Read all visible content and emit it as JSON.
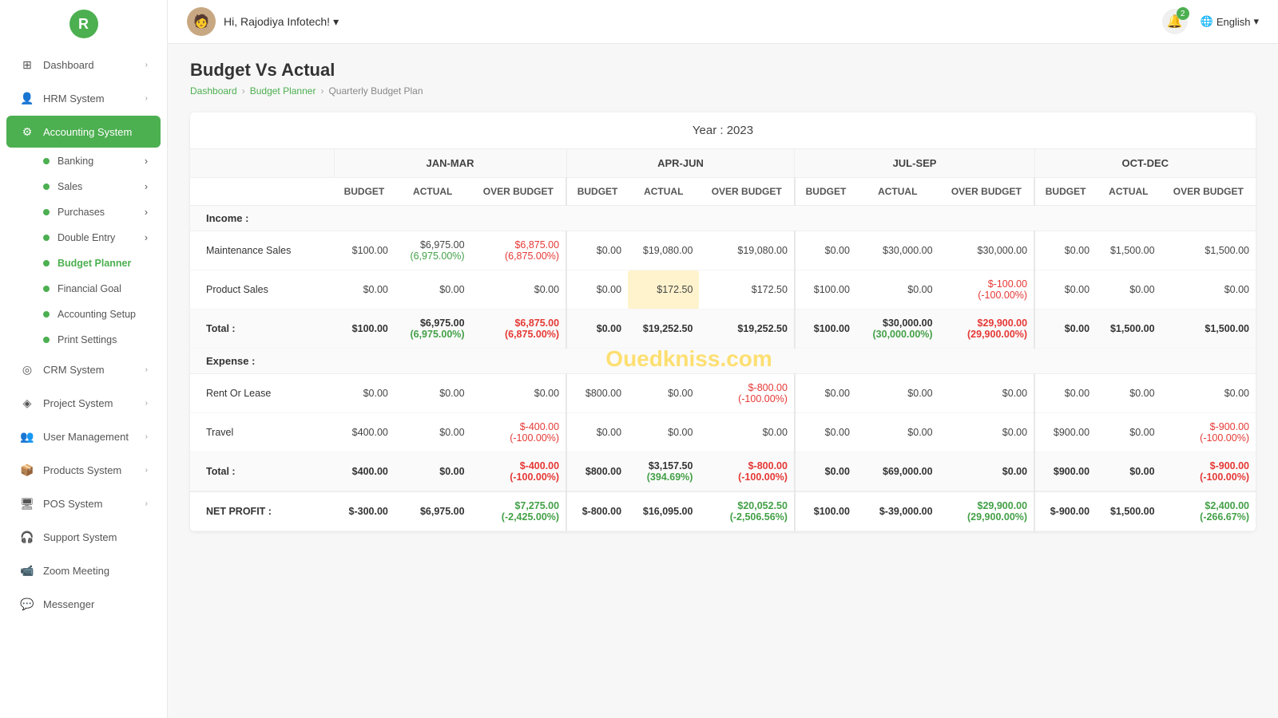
{
  "topbar": {
    "greeting": "Hi, Rajodiya Infotech!",
    "notif_count": "2",
    "language": "English"
  },
  "breadcrumb": {
    "home": "Dashboard",
    "parent": "Budget Planner",
    "current": "Quarterly Budget Plan"
  },
  "page": {
    "title": "Budget Vs Actual",
    "year_label": "Year : 2023"
  },
  "sidebar": {
    "logo_char": "R",
    "items": [
      {
        "id": "dashboard",
        "label": "Dashboard",
        "icon": "⊞",
        "has_arrow": true
      },
      {
        "id": "hrm",
        "label": "HRM System",
        "icon": "👤",
        "has_arrow": true
      },
      {
        "id": "accounting",
        "label": "Accounting System",
        "icon": "●",
        "has_arrow": false,
        "active": true
      },
      {
        "id": "banking",
        "label": "Banking",
        "sub": true,
        "dot": "green"
      },
      {
        "id": "sales",
        "label": "Sales",
        "sub": true,
        "dot": "green"
      },
      {
        "id": "purchases",
        "label": "Purchases",
        "sub": true,
        "dot": "green"
      },
      {
        "id": "double-entry",
        "label": "Double Entry",
        "sub": true,
        "dot": "green"
      },
      {
        "id": "budget-planner",
        "label": "Budget Planner",
        "sub": true,
        "dot": "green",
        "active_sub": true
      },
      {
        "id": "financial-goal",
        "label": "Financial Goal",
        "sub": true,
        "dot": "green"
      },
      {
        "id": "accounting-setup",
        "label": "Accounting Setup",
        "sub": true,
        "dot": "green"
      },
      {
        "id": "print-settings",
        "label": "Print Settings",
        "sub": true,
        "dot": "green"
      },
      {
        "id": "crm",
        "label": "CRM System",
        "icon": "◎",
        "has_arrow": true
      },
      {
        "id": "project",
        "label": "Project System",
        "icon": "◈",
        "has_arrow": true
      },
      {
        "id": "user-mgmt",
        "label": "User Management",
        "icon": "👥",
        "has_arrow": true
      },
      {
        "id": "products",
        "label": "Products System",
        "icon": "📦",
        "has_arrow": true
      },
      {
        "id": "pos",
        "label": "POS System",
        "icon": "🖥",
        "has_arrow": true
      },
      {
        "id": "support",
        "label": "Support System",
        "icon": "🎧"
      },
      {
        "id": "zoom",
        "label": "Zoom Meeting",
        "icon": "📹"
      },
      {
        "id": "messenger",
        "label": "Messenger",
        "icon": "💬"
      }
    ]
  },
  "table": {
    "quarters": [
      {
        "label": "JAN-MAR"
      },
      {
        "label": "APR-JUN"
      },
      {
        "label": "JUL-SEP"
      },
      {
        "label": "OCT-DEC"
      }
    ],
    "col_headers": [
      "BUDGET",
      "ACTUAL",
      "OVER BUDGET"
    ],
    "income_section": "Income :",
    "expense_section": "Expense :",
    "income_rows": [
      {
        "label": "Maintenance Sales",
        "jan_mar_budget": "$100.00",
        "jan_mar_actual": "$6,975.00\n(6,975.00%)",
        "jan_mar_over": "$6,875.00\n(6,875.00%)",
        "apr_jun_budget": "$0.00",
        "apr_jun_actual": "$19,080.00",
        "apr_jun_over": "$19,080.00",
        "jul_sep_budget": "$0.00",
        "jul_sep_actual": "$30,000.00",
        "jul_sep_over": "$30,000.00",
        "oct_dec_budget": "$0.00",
        "oct_dec_actual": "$1,500.00",
        "oct_dec_over": "$1,500.00"
      },
      {
        "label": "Product Sales",
        "jan_mar_budget": "$0.00",
        "jan_mar_actual": "$0.00",
        "jan_mar_over": "$0.00",
        "apr_jun_budget": "$0.00",
        "apr_jun_actual": "$172.50",
        "apr_jun_over": "$172.50",
        "jul_sep_budget": "$100.00",
        "jul_sep_actual": "$0.00",
        "jul_sep_over": "$-100.00\n(-100.00%)",
        "oct_dec_budget": "$0.00",
        "oct_dec_actual": "$0.00",
        "oct_dec_over": "$0.00"
      }
    ],
    "income_total": {
      "label": "Total :",
      "jan_mar_budget": "$100.00",
      "jan_mar_actual": "$6,975.00\n(6,975.00%)",
      "jan_mar_over": "$6,875.00\n(6,875.00%)",
      "apr_jun_budget": "$0.00",
      "apr_jun_actual": "$19,252.50",
      "apr_jun_over": "$19,252.50",
      "jul_sep_budget": "$100.00",
      "jul_sep_actual": "$30,000.00\n(30,000.00%)",
      "jul_sep_over": "$29,900.00\n(29,900.00%)",
      "oct_dec_budget": "$0.00",
      "oct_dec_actual": "$1,500.00",
      "oct_dec_over": "$1,500.00"
    },
    "expense_rows": [
      {
        "label": "Rent Or Lease",
        "jan_mar_budget": "$0.00",
        "jan_mar_actual": "$0.00",
        "jan_mar_over": "$0.00",
        "apr_jun_budget": "$800.00",
        "apr_jun_actual": "$0.00",
        "apr_jun_over": "$-800.00\n(-100.00%)",
        "jul_sep_budget": "$0.00",
        "jul_sep_actual": "$0.00",
        "jul_sep_over": "$0.00",
        "oct_dec_budget": "$0.00",
        "oct_dec_actual": "$0.00",
        "oct_dec_over": "$0.00"
      },
      {
        "label": "Travel",
        "jan_mar_budget": "$400.00",
        "jan_mar_actual": "$0.00",
        "jan_mar_over": "$-400.00\n(-100.00%)",
        "apr_jun_budget": "$0.00",
        "apr_jun_actual": "$0.00",
        "apr_jun_over": "$0.00",
        "jul_sep_budget": "$0.00",
        "jul_sep_actual": "$0.00",
        "jul_sep_over": "$0.00",
        "oct_dec_budget": "$900.00",
        "oct_dec_actual": "$0.00",
        "oct_dec_over": "$-900.00\n(-100.00%)"
      }
    ],
    "expense_total": {
      "label": "Total :",
      "jan_mar_budget": "$400.00",
      "jan_mar_actual": "$0.00",
      "jan_mar_over": "$-400.00\n(-100.00%)",
      "apr_jun_budget": "$800.00",
      "apr_jun_actual": "$3,157.50\n(394.69%)",
      "apr_jun_over": "$-800.00\n(-100.00%)",
      "jul_sep_budget": "$0.00",
      "jul_sep_actual": "$69,000.00",
      "jul_sep_over": "$0.00",
      "oct_dec_budget": "$900.00",
      "oct_dec_actual": "$0.00",
      "oct_dec_over": "$-900.00\n(-100.00%)"
    },
    "net_profit": {
      "label": "NET PROFIT :",
      "jan_mar_budget": "$-300.00",
      "jan_mar_actual": "$6,975.00",
      "jan_mar_over": "$7,275.00\n(-2,425.00%)",
      "apr_jun_budget": "$-800.00",
      "apr_jun_actual": "$16,095.00",
      "apr_jun_over": "$20,052.50\n(-2,506.56%)",
      "jul_sep_budget": "$100.00",
      "jul_sep_actual": "$-39,000.00",
      "jul_sep_over": "$29,900.00\n(29,900.00%)",
      "oct_dec_budget": "$-900.00",
      "oct_dec_actual": "$1,500.00",
      "oct_dec_over": "$2,400.00\n(-266.67%)"
    }
  }
}
